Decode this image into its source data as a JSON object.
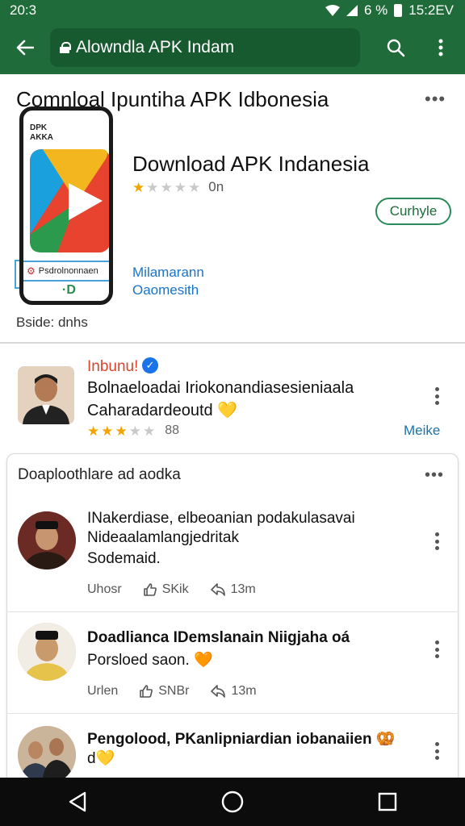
{
  "status_bar": {
    "time": "20:3",
    "battery_text": "6 %",
    "clock_right": "15:2EV"
  },
  "app_bar": {
    "url": "Alowndla APK Indam",
    "icons": [
      "back-arrow-icon",
      "lock-icon",
      "search-icon",
      "more-vert-icon"
    ]
  },
  "header": {
    "page_title": "Comnloal Ipuntiha APK Idbonesia",
    "more": "•••",
    "phone_label_line1": "DPK",
    "phone_label_line2": "AKKA",
    "phone_sub_label": "Psdrolnonnaen",
    "phone_sub_letter": "·D",
    "app_name": "Download APK Indanesia",
    "rating_stars": 1,
    "rating_max": 5,
    "rating_count": "0n",
    "install_label": "Curhyle",
    "developer_line1": "Milamarann",
    "developer_line2": "Oaomesith",
    "size_label": "Bside: dnhs"
  },
  "featured_review": {
    "name": "Inbunu!",
    "text_line1": "Bolnaeloadai Iriokonandiasesieniaala",
    "text_line2": "Caharadardeoutd 💛",
    "rating_stars": 3,
    "rating_count": "88",
    "more_link": "Meike"
  },
  "reviews_card": {
    "title": "Doaploothlare ad aodka",
    "more": "•••",
    "reviews": [
      {
        "text_lines": [
          "INakerdiase, elbeoanian podakulasavai",
          "Nideaalamlangjedritak",
          "Sodemaid."
        ],
        "author": "Uhosr",
        "likes": "SKik",
        "time": "13m"
      },
      {
        "text_lines": [
          "Doadlianca IDemslanain Niigjaha oá",
          "Porsloed saon. 🧡"
        ],
        "author": "Urlen",
        "likes": "SNBr",
        "time": "13m"
      },
      {
        "text_lines": [
          "Pengolood, PKanlipniardian iobanaiien 🥨",
          "d💛"
        ],
        "author": "",
        "likes": "",
        "time": ""
      }
    ]
  },
  "colors": {
    "primary": "#1f6b3a",
    "accent_red": "#d9442b",
    "link_blue": "#1a73c8",
    "star": "#f2a400"
  }
}
